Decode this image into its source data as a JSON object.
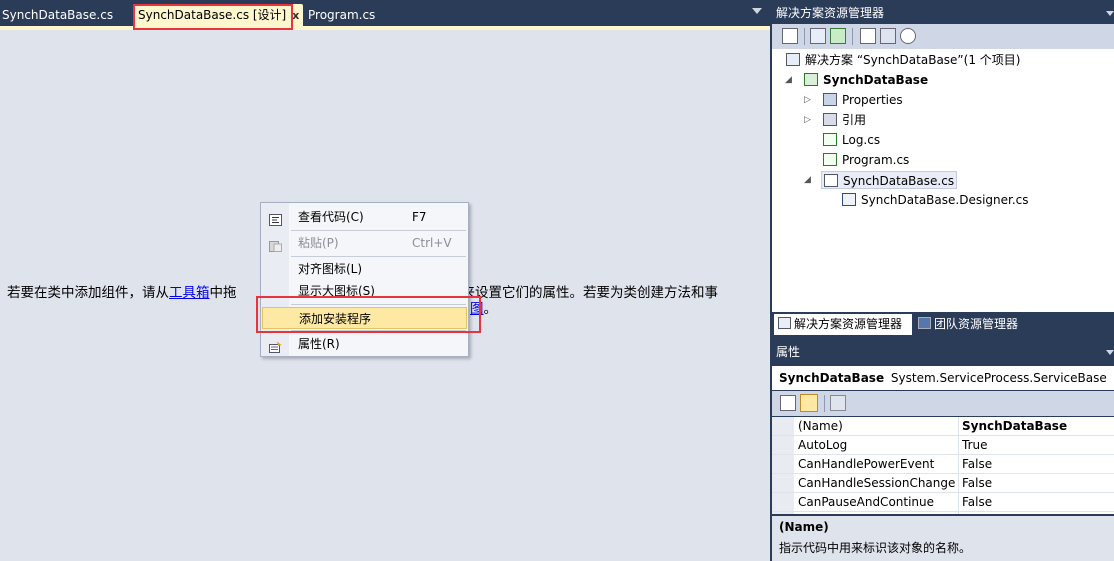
{
  "tabs": [
    {
      "label": "SynchDataBase.cs",
      "active": false
    },
    {
      "label": "SynchDataBase.cs [设计]",
      "active": true,
      "close_glyph": "x"
    },
    {
      "label": "Program.cs",
      "active": false
    }
  ],
  "designer": {
    "hint_part1": "若要在类中添加组件，请从",
    "hint_link1": "工具箱",
    "hint_part2": "中拖",
    "hint_part3": "来设置它们的属性。若要为类创建方法和事",
    "hint_link2": "图",
    "hint_part4": "。"
  },
  "context_menu": {
    "items": [
      {
        "label": "查看代码(C)",
        "shortcut": "F7",
        "icon": "view-code-icon",
        "enabled": true
      },
      {
        "label": "粘贴(P)",
        "shortcut": "Ctrl+V",
        "icon": "paste-icon",
        "enabled": false
      },
      {
        "label": "对齐图标(L)",
        "shortcut": "",
        "icon": "",
        "enabled": true
      },
      {
        "label": "显示大图标(S)",
        "shortcut": "",
        "icon": "",
        "enabled": true
      },
      {
        "label": "添加安装程序",
        "shortcut": "",
        "icon": "",
        "enabled": true,
        "highlighted": true
      },
      {
        "label": "属性(R)",
        "shortcut": "",
        "icon": "properties-icon",
        "enabled": true
      }
    ]
  },
  "solution_explorer": {
    "title": "解决方案资源管理器",
    "tree": {
      "solution": "解决方案 “SynchDataBase”(1 个项目)",
      "project": "SynchDataBase",
      "properties": "Properties",
      "references": "引用",
      "log": "Log.cs",
      "program": "Program.cs",
      "synch": "SynchDataBase.cs",
      "designer": "SynchDataBase.Designer.cs"
    },
    "bottom_tabs": [
      "解决方案资源管理器",
      "团队资源管理器"
    ]
  },
  "properties_panel": {
    "title": "属性",
    "object_name": "SynchDataBase",
    "object_type": "System.ServiceProcess.ServiceBase",
    "rows": [
      {
        "name": "(Name)",
        "value": "SynchDataBase"
      },
      {
        "name": "AutoLog",
        "value": "True"
      },
      {
        "name": "CanHandlePowerEvent",
        "value": "False"
      },
      {
        "name": "CanHandleSessionChangeEvent",
        "value": "False"
      },
      {
        "name": "CanPauseAndContinue",
        "value": "False"
      }
    ],
    "description_title": "(Name)",
    "description_text": "指示代码中用来标识该对象的名称。"
  },
  "colors": {
    "chrome": "#2b3c59",
    "active_tab": "#fef6cc",
    "design_surface": "#dfe3ec",
    "menu_highlight": "#fde8a4",
    "annotation_red": "#e8343c",
    "link": "#0000ee"
  }
}
